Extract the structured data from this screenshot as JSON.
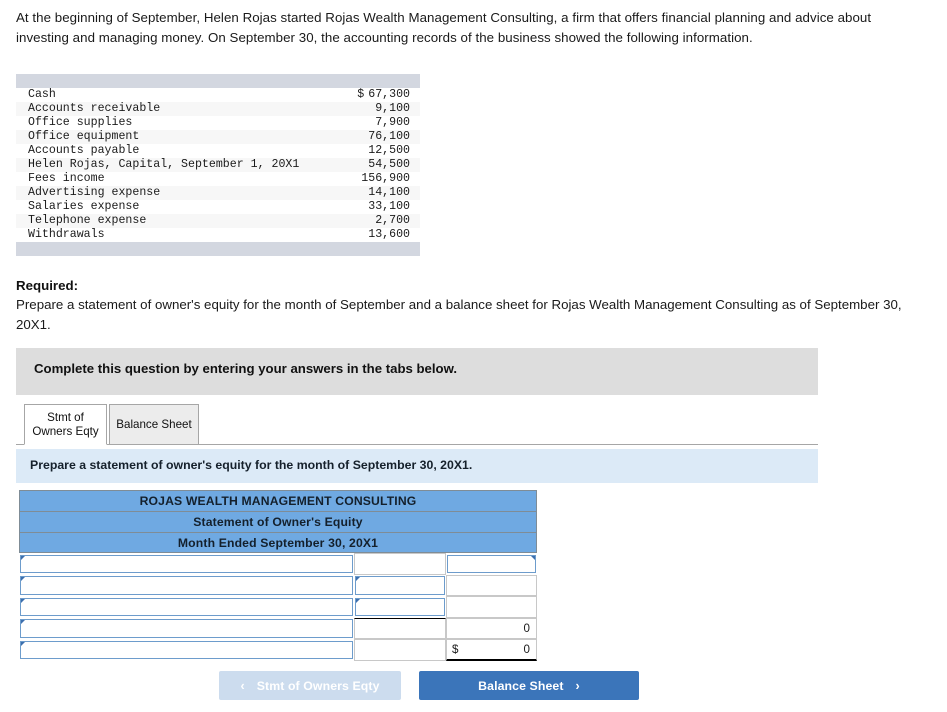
{
  "intro": {
    "text": "At the beginning of September, Helen Rojas started Rojas Wealth Management Consulting, a firm that offers financial planning and advice about investing and managing money. On September 30, the accounting records of the business showed the following information."
  },
  "accounts": {
    "rows": [
      {
        "name": "Cash",
        "currency": "$",
        "amount": "67,300"
      },
      {
        "name": "Accounts receivable",
        "currency": "",
        "amount": "9,100"
      },
      {
        "name": "Office supplies",
        "currency": "",
        "amount": "7,900"
      },
      {
        "name": "Office equipment",
        "currency": "",
        "amount": "76,100"
      },
      {
        "name": "Accounts payable",
        "currency": "",
        "amount": "12,500"
      },
      {
        "name": "Helen Rojas, Capital, September 1, 20X1",
        "currency": "",
        "amount": "54,500"
      },
      {
        "name": "Fees income",
        "currency": "",
        "amount": "156,900"
      },
      {
        "name": "Advertising expense",
        "currency": "",
        "amount": "14,100"
      },
      {
        "name": "Salaries expense",
        "currency": "",
        "amount": "33,100"
      },
      {
        "name": "Telephone expense",
        "currency": "",
        "amount": "2,700"
      },
      {
        "name": "Withdrawals",
        "currency": "",
        "amount": "13,600"
      }
    ]
  },
  "required": {
    "label": "Required:",
    "body": "Prepare a statement of owner's equity for the month of September and a balance sheet for Rojas Wealth Management Consulting as of September 30, 20X1."
  },
  "banner": {
    "text": "Complete this question by entering your answers in the tabs below."
  },
  "tabs": [
    {
      "id": "stmt-owners-eqty",
      "label_line1": "Stmt of",
      "label_line2": "Owners Eqty",
      "active": true
    },
    {
      "id": "balance-sheet",
      "label_line1": "Balance Sheet",
      "label_line2": "",
      "active": false
    }
  ],
  "tab_instruction": {
    "text": "Prepare a statement of owner's equity for the month of September 30, 20X1."
  },
  "statement": {
    "header_lines": [
      "ROJAS WEALTH MANAGEMENT CONSULTING",
      "Statement of Owner's Equity",
      "Month Ended September 30, 20X1"
    ],
    "rows": [
      {
        "label_value": "",
        "col2_value": "",
        "col3_value": "",
        "col3_currency": ""
      },
      {
        "label_value": "",
        "col2_value": "",
        "col3_value": "",
        "col3_currency": ""
      },
      {
        "label_value": "",
        "col2_value": "",
        "col3_value": "",
        "col3_currency": ""
      },
      {
        "label_value": "",
        "col2_value": "",
        "col3_value": "0",
        "col3_currency": ""
      },
      {
        "label_value": "",
        "col2_value": "",
        "col3_value": "0",
        "col3_currency": "$"
      }
    ]
  },
  "nav": {
    "prev_label": "Stmt of Owners Eqty",
    "prev_chevron": "‹",
    "next_label": "Balance Sheet",
    "next_chevron": "›"
  },
  "colors": {
    "header_blue": "#6fa9e2",
    "instruction_blue": "#dceaf7",
    "banner_gray": "#dddddd",
    "band_gray": "#d3d7e0",
    "button_active": "#3b75ba",
    "button_disabled": "#ccdcee",
    "input_border": "#6d9ccc"
  }
}
